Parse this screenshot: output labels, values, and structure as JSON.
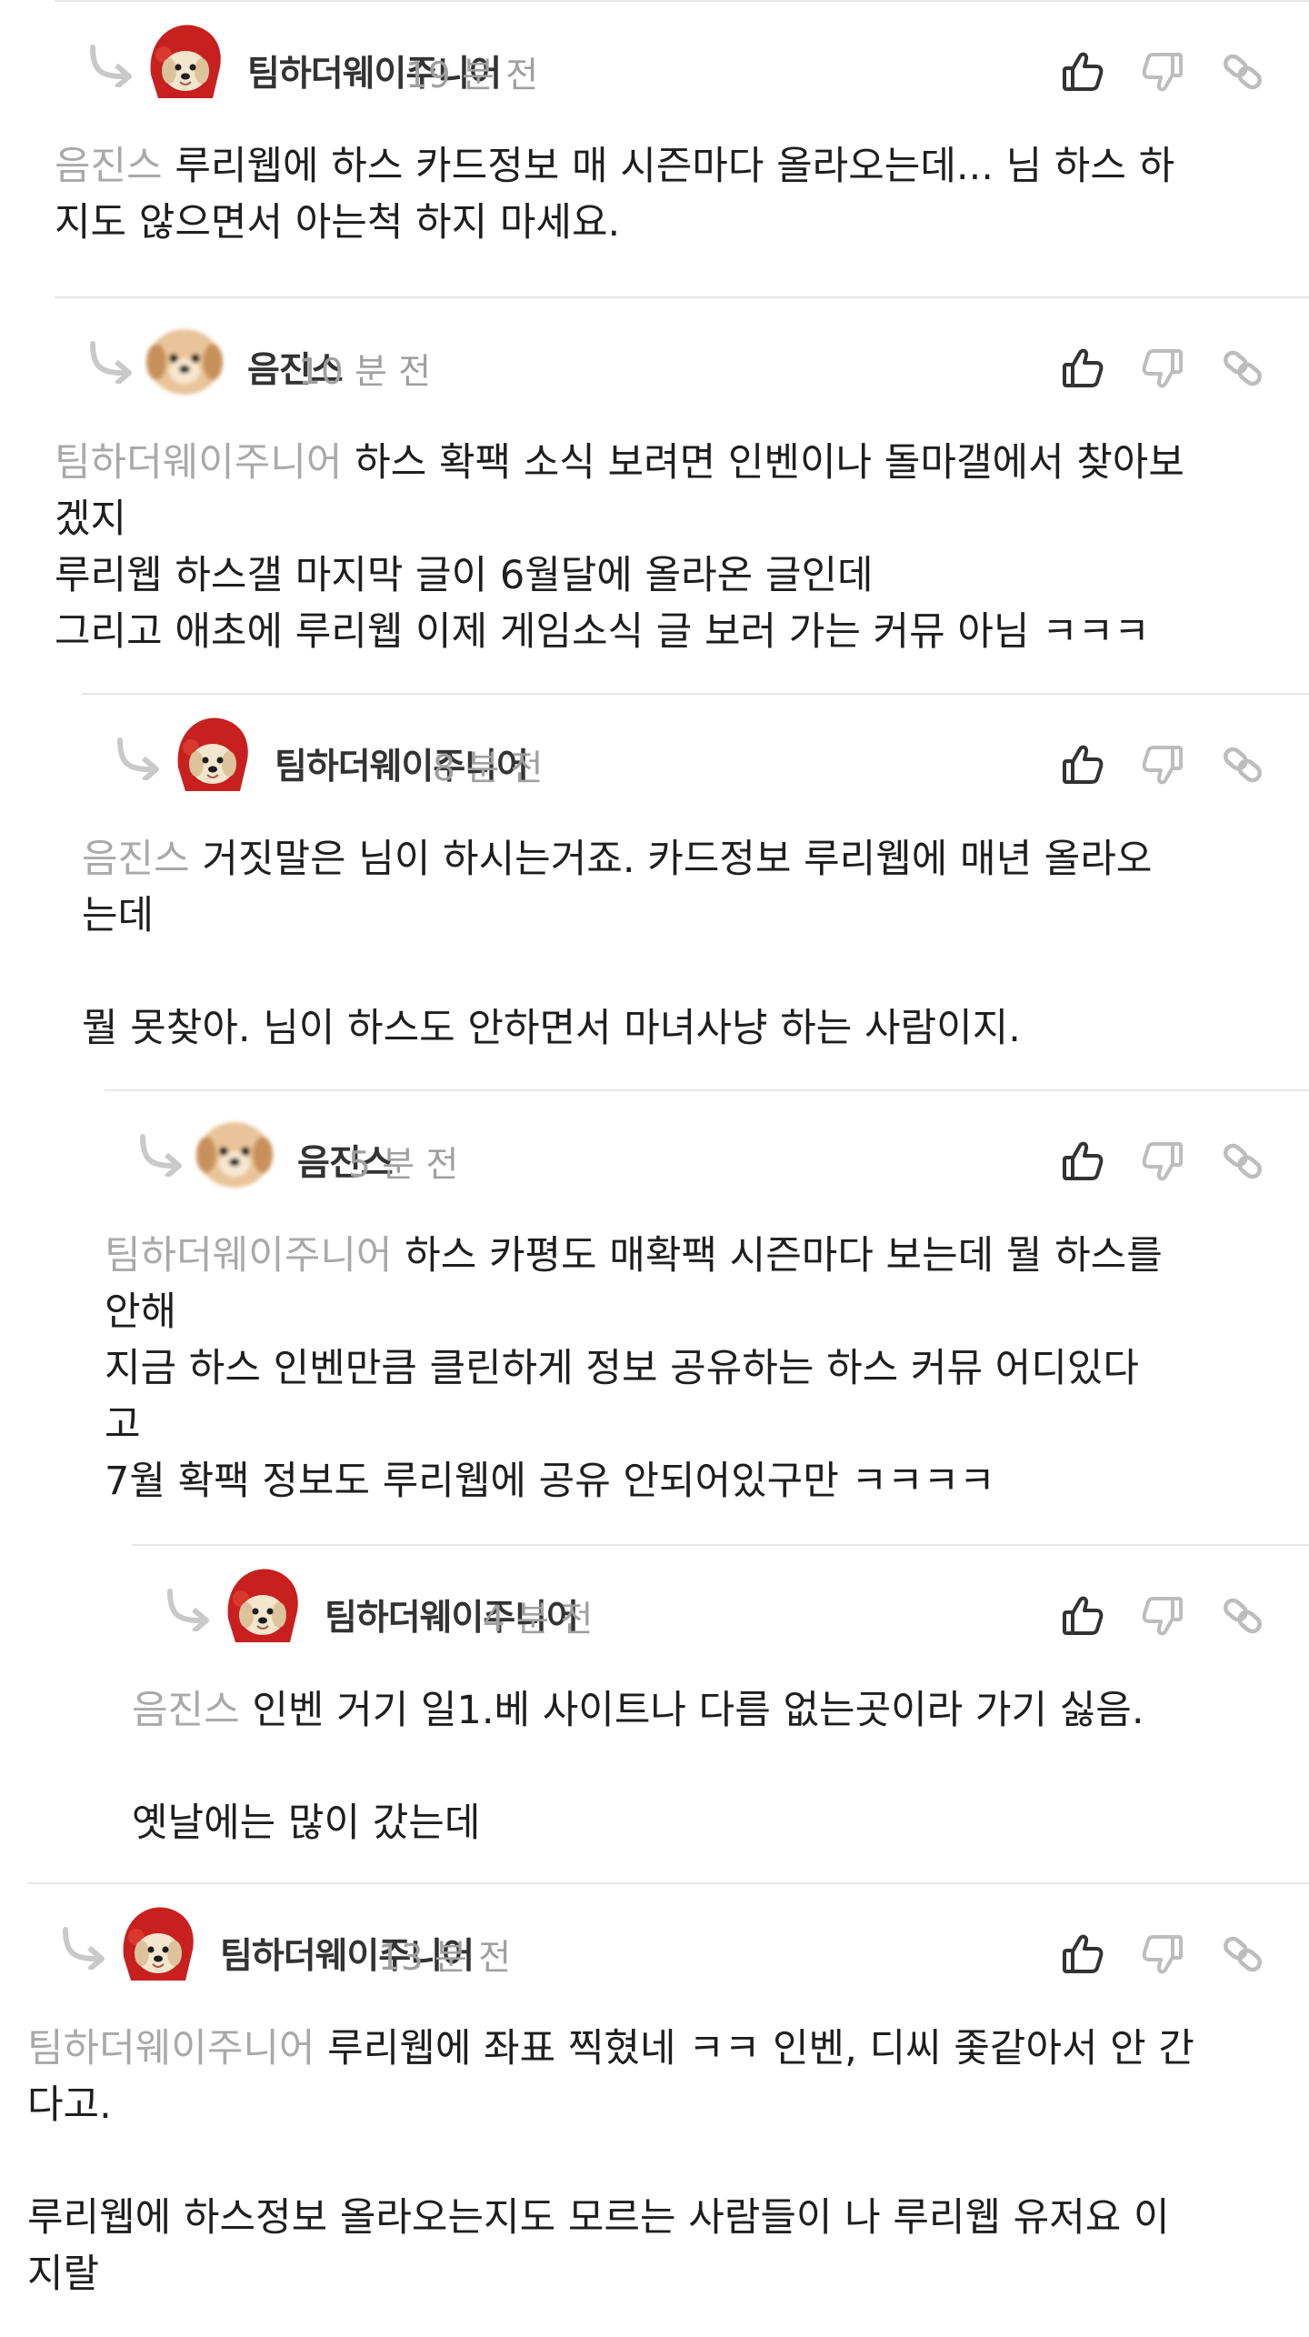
{
  "thread": {
    "comments": [
      {
        "author": "팀하더웨이주니어",
        "avatar": "dog-red-hood",
        "time": "19 분 전",
        "mention": "음진스",
        "lines": [
          "루리웹에 하스 카드정보 매 시즌마다 올라오는데... 님 하스 하",
          "지도 않으면서 아는척 하지 마세요."
        ]
      },
      {
        "author": "음진스",
        "avatar": "puppy-face",
        "time": "10 분 전",
        "mention": "팀하더웨이주니어",
        "lines": [
          "하스 확팩 소식 보려면 인벤이나 돌마갤에서 찾아보",
          "겠지",
          "루리웹 하스갤 마지막 글이 6월달에 올라온 글인데",
          "그리고 애초에 루리웹 이제 게임소식 글 보러 가는 커뮤 아님 ㅋㅋㅋ"
        ]
      },
      {
        "author": "팀하더웨이주니어",
        "avatar": "dog-red-hood",
        "time": "8 분 전",
        "mention": "음진스",
        "lines": [
          "거짓말은 님이 하시는거죠. 카드정보 루리웹에 매년 올라오",
          "는데",
          "",
          "뭘 못찾아. 님이 하스도 안하면서 마녀사냥 하는 사람이지."
        ]
      },
      {
        "author": "음진스",
        "avatar": "puppy-face",
        "time": "5 분 전",
        "mention": "팀하더웨이주니어",
        "lines": [
          "하스 카평도 매확팩 시즌마다 보는데 뭘 하스를",
          "안해",
          "지금 하스 인벤만큼 클린하게 정보 공유하는 하스 커뮤 어디있다",
          "고",
          "7월 확팩 정보도 루리웹에 공유 안되어있구만 ㅋㅋㅋㅋ"
        ]
      },
      {
        "author": "팀하더웨이주니어",
        "avatar": "dog-red-hood",
        "time": "4 분 전",
        "mention": "음진스",
        "lines": [
          "인벤 거기 일1.베 사이트나 다름 없는곳이라 가기 싫음.",
          "",
          "옛날에는 많이 갔는데"
        ]
      },
      {
        "author": "팀하더웨이주니어",
        "avatar": "dog-red-hood",
        "time": "13 분 전",
        "mention": "팀하더웨이주니어",
        "lines": [
          "루리웹에 좌표 찍혔네 ㅋㅋ 인벤, 디씨 좇같아서 안 간",
          "다고.",
          "",
          "루리웹에 하스정보 올라오는지도 모르는 사람들이 나 루리웹 유저요 이",
          "지랄"
        ]
      }
    ],
    "icons": {
      "reply": "reply-arrow-icon",
      "like": "thumbs-up-icon",
      "dislike": "thumbs-down-icon",
      "share": "link-icon"
    },
    "colors": {
      "mention": "#a9a9a9",
      "time": "#a0a0a0",
      "divider": "#e6e6e6",
      "like_icon": "#333333",
      "dislike_icon": "#bdbdbd",
      "share_icon": "#bdbdbd"
    }
  }
}
